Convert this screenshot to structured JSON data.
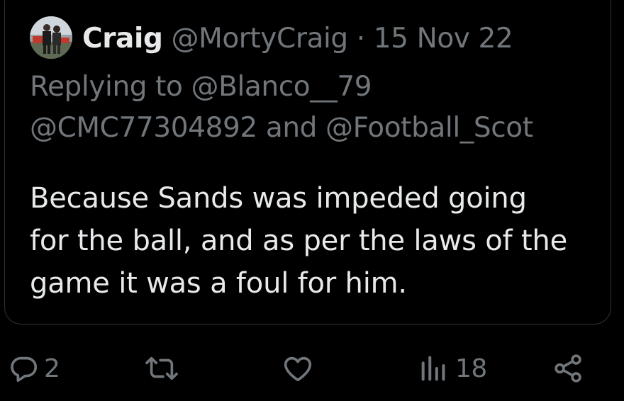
{
  "tweet": {
    "display_name": "Craig",
    "handle": "@MortyCraig",
    "separator": "·",
    "date": "15 Nov 22",
    "replying_prefix": "Replying to",
    "replying_first": "@Blanco__79",
    "replying_second": "@CMC77304892",
    "replying_and": "and",
    "replying_third": "@Football_Scot",
    "body_lines": [
      "Because Sands was impeded going",
      "for the ball, and as per the laws of the",
      "game it was a foul for him."
    ]
  },
  "actions": {
    "reply_count": "2",
    "views_count": "18"
  },
  "icons": {
    "reply": "reply-icon",
    "retweet": "retweet-icon",
    "like": "heart-icon",
    "views": "views-icon",
    "share": "share-icon"
  },
  "colors": {
    "background": "#000000",
    "text": "#e7e9ea",
    "muted": "#71767b",
    "border": "#2f3336"
  }
}
